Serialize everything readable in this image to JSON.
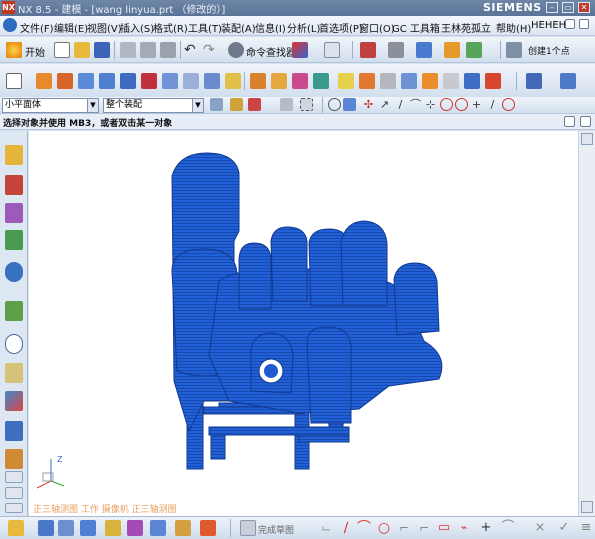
{
  "title_bar": {
    "logo": "NX",
    "text": "NX 8.5 - 建模 - [wang linyua.prt （修改的）]",
    "brand": "SIEMENS",
    "buttons": [
      "minimize-icon",
      "restore-icon",
      "close-icon"
    ]
  },
  "menu": {
    "items": [
      "文件(F)",
      "编辑(E)",
      "视图(V)",
      "插入(S)",
      "格式(R)",
      "工具(T)",
      "装配(A)",
      "信息(I)",
      "分析(L)",
      "首选项(P)",
      "窗口(O)",
      "GC 工具箱",
      "王林苑",
      "孤立",
      "帮助(H)",
      "HEHEH"
    ]
  },
  "toolbar1": {
    "start_label": "开始",
    "command_finder_label": "命令查找器",
    "create_point_label": "创建1个点"
  },
  "selection_bar": {
    "filter_value": "小平面体",
    "scope_value": "整个装配"
  },
  "cue_line": {
    "text": "选择对象并使用 MB3，或者双击某一对象"
  },
  "viewport": {
    "triad_label": "Z",
    "orientation_labels": "正三轴测图 工作 摄像机 正三轴测图",
    "model_color": "#1f5ad1"
  },
  "bottom_toolbar": {
    "sketch_label": "完成草图"
  },
  "colors": {
    "accent": "#1f5ad1",
    "toolbar": "#dbe5f1",
    "titlebar": "#5f7799"
  }
}
